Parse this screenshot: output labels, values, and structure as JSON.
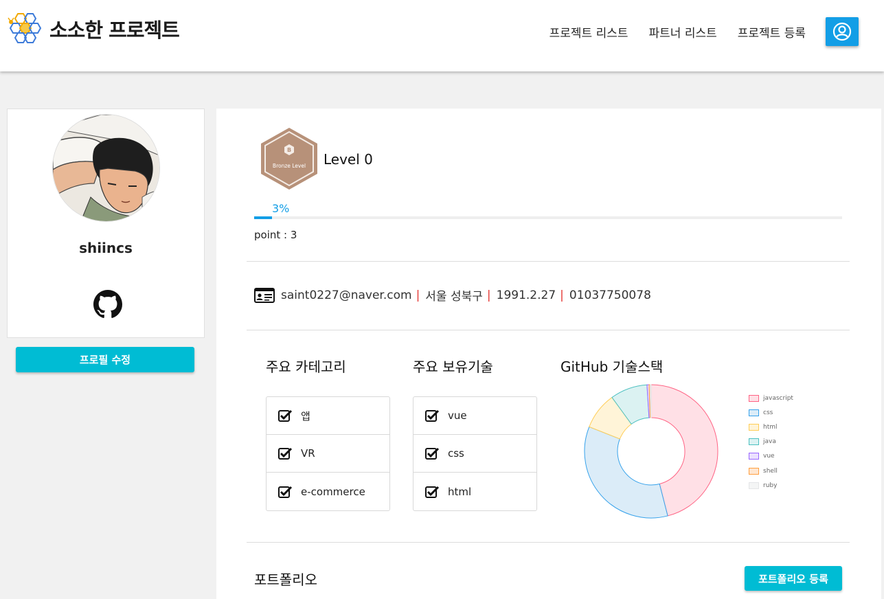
{
  "header": {
    "logo_text": "소소한 프로젝트",
    "nav": [
      "프로젝트 리스트",
      "파트너 리스트",
      "프로젝트 등록"
    ]
  },
  "profile": {
    "username": "shiincs",
    "edit_button": "프로필 수정"
  },
  "level": {
    "badge_letter": "B",
    "badge_text": "Bronze Level",
    "label": "Level 0",
    "progress_text": "3%",
    "progress_fraction": 0.03,
    "point_text": "point : 3"
  },
  "contact": {
    "email": "saint0227@naver.com",
    "location": "서울 성북구",
    "birth": "1991.2.27",
    "phone": "01037750078"
  },
  "categories": {
    "title": "주요 카테고리",
    "items": [
      "앱",
      "VR",
      "e-commerce"
    ]
  },
  "skills": {
    "title": "주요 보유기술",
    "items": [
      "vue",
      "css",
      "html"
    ]
  },
  "github_stack": {
    "title": "GitHub 기술스택"
  },
  "chart_data": {
    "type": "pie",
    "donut": true,
    "labels": [
      "javascript",
      "css",
      "html",
      "java",
      "vue",
      "shell",
      "ruby"
    ],
    "values": [
      46,
      35,
      9,
      9,
      0.5,
      0.3,
      0.2
    ],
    "fill_colors": [
      "#ffe0e6",
      "#dbecf8",
      "#fff4d8",
      "#dbf2f2",
      "#ebe0ff",
      "#ffe6d0",
      "#f4f5f5"
    ],
    "border_colors": [
      "#ff6384",
      "#36a2eb",
      "#ffcd56",
      "#4bc0c0",
      "#9966ff",
      "#ff9f40",
      "#e4e5e7"
    ],
    "legend_position": "right"
  },
  "portfolio": {
    "title": "포트폴리오",
    "add_button": "포트폴리오 등록"
  },
  "colors": {
    "accent": "#00bcd4",
    "primary": "#139ee6",
    "separator": "#e53935"
  }
}
